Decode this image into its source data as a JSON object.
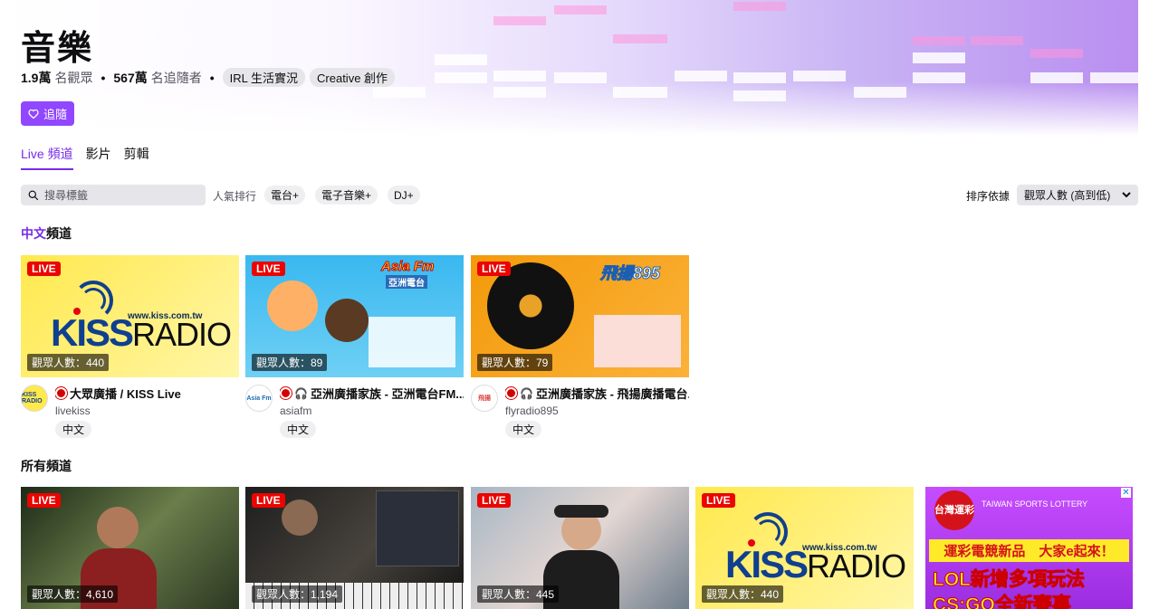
{
  "category": {
    "title": "音樂",
    "viewers_count": "1.9萬",
    "viewers_label": "名觀眾",
    "followers_count": "567萬",
    "followers_label": "名追隨者",
    "tags": [
      "IRL 生活實況",
      "Creative 創作"
    ],
    "follow_label": "追隨"
  },
  "tabs": [
    {
      "label": "Live 頻道",
      "active": true
    },
    {
      "label": "影片",
      "active": false
    },
    {
      "label": "剪輯",
      "active": false
    }
  ],
  "filters": {
    "search_placeholder": "搜尋標籤",
    "popular_label": "人氣排行",
    "chips": [
      "電台",
      "電子音樂",
      "DJ"
    ],
    "sort_label": "排序依據",
    "sort_value": "觀眾人數 (高到低)"
  },
  "sections": {
    "chinese_prefix": "中文",
    "chinese_suffix": "頻道",
    "all": "所有頻道"
  },
  "chinese_channels": [
    {
      "live": "LIVE",
      "viewers": "觀眾人數：440",
      "title": "大眾廣播 / KISS Live",
      "name": "livekiss",
      "tag": "中文",
      "avatar": "KISS RADIO"
    },
    {
      "live": "LIVE",
      "viewers": "觀眾人數：89",
      "title": "亞洲廣播家族 - 亞洲電台FM...",
      "name": "asiafm",
      "tag": "中文",
      "avatar": "Asia Fm"
    },
    {
      "live": "LIVE",
      "viewers": "觀眾人數：79",
      "title": "亞洲廣播家族 - 飛揚廣播電台...",
      "name": "flyradio895",
      "tag": "中文",
      "avatar": "飛揚"
    }
  ],
  "kiss_thumb": {
    "url": "www.kiss.com.tw",
    "logo_a": "KISS",
    "logo_b": "RADIO"
  },
  "asia_thumb": {
    "brand": "Asia Fm",
    "sub": "亞洲電台"
  },
  "fly_thumb": {
    "brand": "飛揚895"
  },
  "all_channels": [
    {
      "live": "LIVE",
      "viewers": "觀眾人數：4,610"
    },
    {
      "live": "LIVE",
      "viewers": "觀眾人數：1,194"
    },
    {
      "live": "LIVE",
      "viewers": "觀眾人數：445"
    },
    {
      "live": "LIVE",
      "viewers": "觀眾人數：440"
    }
  ],
  "ad": {
    "close": "✕",
    "logo": "台灣運彩",
    "brand": "TAIWAN SPORTS LOTTERY",
    "line1": "運彩電競新品　大家e起來！",
    "line2": "LOL新增多項玩法",
    "line3": "CS:GO全新賽事"
  },
  "colors": {
    "accent": "#9147ff",
    "live": "#eb0400"
  }
}
